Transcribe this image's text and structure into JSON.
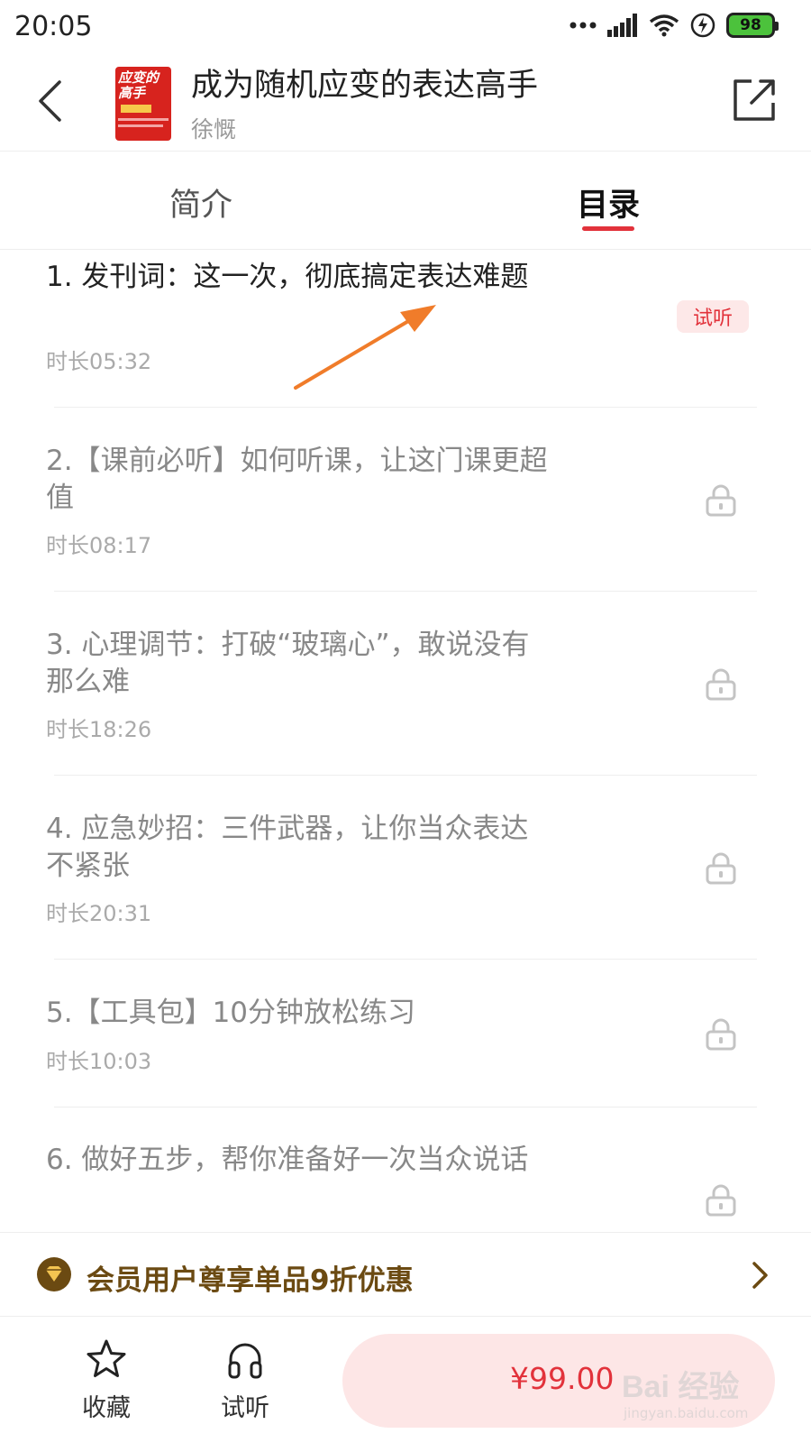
{
  "status_bar": {
    "time": "20:05",
    "battery": "98",
    "icons": [
      "more-dots-icon",
      "signal-icon",
      "wifi-icon",
      "charging-icon",
      "battery-icon"
    ]
  },
  "header": {
    "title": "成为随机应变的表达高手",
    "author": "徐慨",
    "cover_text": "应变的 高手",
    "icons": [
      "back-chevron-icon",
      "share-icon"
    ]
  },
  "tabs": [
    {
      "label": "简介",
      "selected": false
    },
    {
      "label": "目录",
      "selected": true
    }
  ],
  "lessons": [
    {
      "title": "1. 发刊词：这一次，彻底搞定表达难题",
      "duration": "时长05:32",
      "badge": "试听",
      "locked": false
    },
    {
      "title": "2.【课前必听】如何听课，让这门课更超值",
      "duration": "时长08:17",
      "badge": "",
      "locked": true
    },
    {
      "title": "3. 心理调节：打破“玻璃心”，敢说没有那么难",
      "duration": "时长18:26",
      "badge": "",
      "locked": true
    },
    {
      "title": "4. 应急妙招：三件武器，让你当众表达不紧张",
      "duration": "时长20:31",
      "badge": "",
      "locked": true
    },
    {
      "title": "5.【工具包】10分钟放松练习",
      "duration": "时长10:03",
      "badge": "",
      "locked": true
    },
    {
      "title": "6. 做好五步，帮你准备好一次当众说话",
      "duration": "",
      "badge": "",
      "locked": true
    }
  ],
  "member_bar": {
    "text": "会员用户尊享单品9折优惠"
  },
  "bottom_bar": {
    "favorite_label": "收藏",
    "listen_label": "试听",
    "price": "¥99.00"
  },
  "watermark": {
    "main": "Bai 经验",
    "sub": "jingyan.baidu.com"
  },
  "colors": {
    "accent": "#e2323b",
    "badge_bg": "#fde8e8",
    "member_text": "#6b4a12",
    "annotation_arrow": "#f07c2a"
  }
}
